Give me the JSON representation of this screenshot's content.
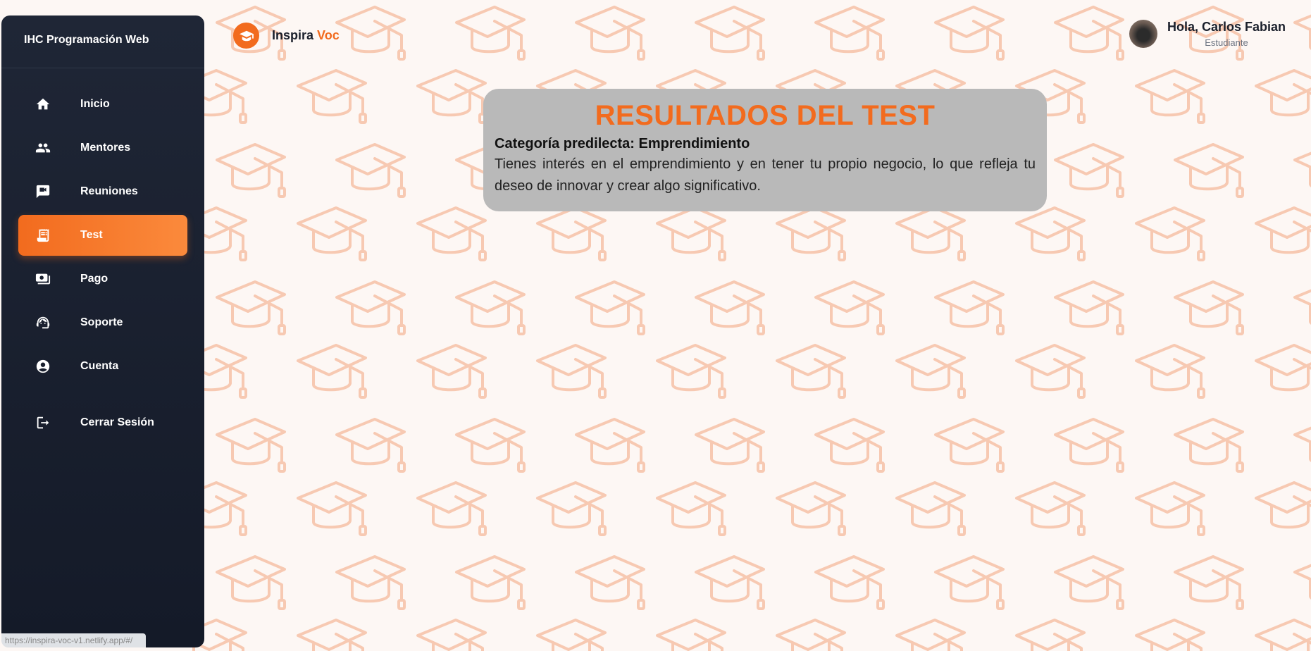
{
  "sidebar": {
    "brand": "IHC Programación Web",
    "items": [
      {
        "label": "Inicio",
        "icon": "home-icon"
      },
      {
        "label": "Mentores",
        "icon": "people-icon"
      },
      {
        "label": "Reuniones",
        "icon": "meeting-icon"
      },
      {
        "label": "Test",
        "icon": "receipt-icon",
        "active": true
      },
      {
        "label": "Pago",
        "icon": "payment-icon"
      },
      {
        "label": "Soporte",
        "icon": "support-icon"
      },
      {
        "label": "Cuenta",
        "icon": "account-icon"
      }
    ],
    "logout_label": "Cerrar Sesión",
    "status_url": "https://inspira-voc-v1.netlify.app/#/"
  },
  "header": {
    "logo_name": "Inspira",
    "logo_accent": "Voc",
    "greeting": "Hola, Carlos Fabian",
    "role": "Estudiante"
  },
  "results": {
    "title": "RESULTADOS DEL TEST",
    "category": "Categoría predilecta: Emprendimiento",
    "description": "Tienes interés en el emprendimiento y en tener tu propio negocio, lo que refleja tu deseo de innovar y crear algo significativo."
  },
  "colors": {
    "accent": "#f26b1e",
    "sidebar_bg": "#1f2636",
    "card_bg": "#b9b9b9",
    "pattern": "#f7c9b2"
  }
}
